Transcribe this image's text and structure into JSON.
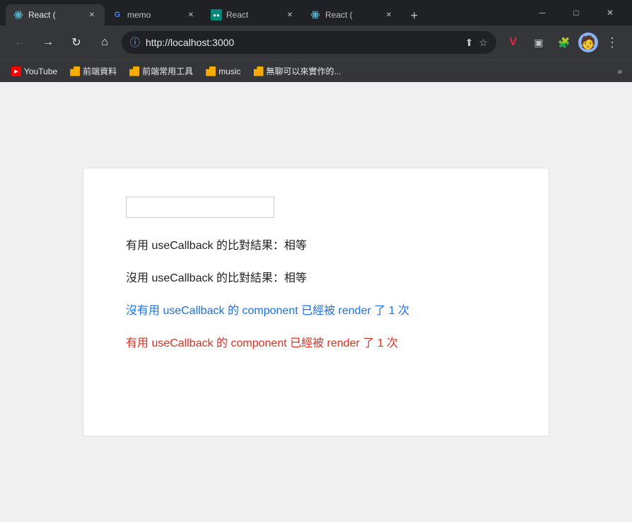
{
  "titlebar": {
    "tabs": [
      {
        "id": "tab-1",
        "icon": "react-icon",
        "label": "React (",
        "active": true,
        "closable": true
      },
      {
        "id": "tab-2",
        "icon": "google-icon",
        "label": "memo",
        "active": false,
        "closable": true
      },
      {
        "id": "tab-3",
        "icon": "meet-icon",
        "label": "React",
        "active": false,
        "closable": true
      },
      {
        "id": "tab-4",
        "icon": "react-icon",
        "label": "React (",
        "active": false,
        "closable": true
      }
    ],
    "new_tab_label": "+",
    "window_controls": {
      "minimize": "─",
      "maximize": "□",
      "close": "✕"
    }
  },
  "navbar": {
    "back_label": "←",
    "forward_label": "→",
    "reload_label": "↻",
    "home_label": "⌂",
    "address": "http://localhost:3000",
    "share_label": "⬆",
    "bookmark_label": "☆",
    "vivaldi_label": "V",
    "more_label": "⋮"
  },
  "bookmarks": [
    {
      "id": "bm-yt",
      "icon": "youtube-icon",
      "label": "YouTube"
    },
    {
      "id": "bm-1",
      "icon": "folder-icon",
      "label": "前端資料"
    },
    {
      "id": "bm-2",
      "icon": "folder-icon",
      "label": "前端常用工具"
    },
    {
      "id": "bm-3",
      "icon": "folder-icon",
      "label": "music"
    },
    {
      "id": "bm-4",
      "icon": "folder-icon",
      "label": "無聊可以來實作的..."
    }
  ],
  "bookmarks_more": "»",
  "page": {
    "input_value": "",
    "input_placeholder": "",
    "lines": [
      {
        "id": "line-1",
        "color": "black",
        "text": "有用 useCallback 的比對結果：相等"
      },
      {
        "id": "line-2",
        "color": "black",
        "text": "沒用 useCallback 的比對結果：相等"
      },
      {
        "id": "line-3",
        "color": "blue",
        "text": "沒有用 useCallback 的 component 已經被 render 了 1 次"
      },
      {
        "id": "line-4",
        "color": "red",
        "text": "有用 useCallback 的 component 已經被 render 了 1 次"
      }
    ]
  }
}
